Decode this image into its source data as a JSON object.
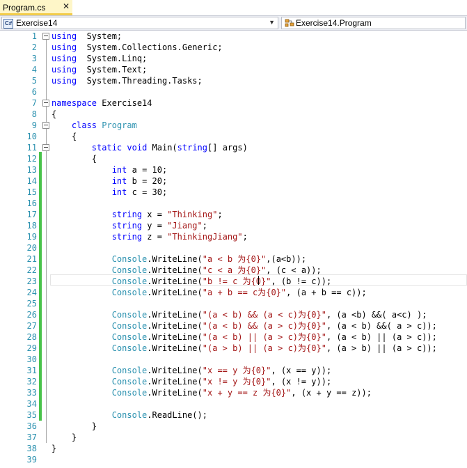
{
  "tab": {
    "label": "Program.cs",
    "close_glyph": "✕"
  },
  "navbar": {
    "project_icon": "C#",
    "project": "Exercise14",
    "member": "Exercise14.Program",
    "dropdown_glyph": "▼"
  },
  "editor": {
    "lines": [
      {
        "n": "1",
        "fold": true,
        "tokens": [
          [
            "kw",
            "using"
          ],
          [
            "",
            "  System;"
          ]
        ]
      },
      {
        "n": "2",
        "fold": false,
        "tokens": [
          [
            "kw",
            "using"
          ],
          [
            "",
            "  System.Collections.Generic;"
          ]
        ]
      },
      {
        "n": "3",
        "fold": false,
        "tokens": [
          [
            "kw",
            "using"
          ],
          [
            "",
            "  System.Linq;"
          ]
        ]
      },
      {
        "n": "4",
        "fold": false,
        "tokens": [
          [
            "kw",
            "using"
          ],
          [
            "",
            "  System.Text;"
          ]
        ]
      },
      {
        "n": "5",
        "fold": false,
        "tokens": [
          [
            "kw",
            "using"
          ],
          [
            "",
            "  System.Threading.Tasks;"
          ]
        ]
      },
      {
        "n": "6",
        "fold": false,
        "tokens": []
      },
      {
        "n": "7",
        "fold": true,
        "tokens": [
          [
            "kw",
            "namespace"
          ],
          [
            "",
            " Exercise14"
          ]
        ]
      },
      {
        "n": "8",
        "fold": false,
        "tokens": [
          [
            "",
            "{"
          ]
        ]
      },
      {
        "n": "9",
        "fold": true,
        "tokens": [
          [
            "",
            "    "
          ],
          [
            "kw",
            "class"
          ],
          [
            "",
            " "
          ],
          [
            "ty",
            "Program"
          ]
        ]
      },
      {
        "n": "10",
        "fold": false,
        "tokens": [
          [
            "",
            "    {"
          ]
        ]
      },
      {
        "n": "11",
        "fold": true,
        "tokens": [
          [
            "",
            "        "
          ],
          [
            "kw",
            "static"
          ],
          [
            "",
            " "
          ],
          [
            "kw",
            "void"
          ],
          [
            "",
            " Main("
          ],
          [
            "kw",
            "string"
          ],
          [
            "",
            "[] args)"
          ]
        ]
      },
      {
        "n": "12",
        "fold": false,
        "tokens": [
          [
            "",
            "        {"
          ]
        ]
      },
      {
        "n": "13",
        "fold": false,
        "tokens": [
          [
            "",
            "            "
          ],
          [
            "kw",
            "int"
          ],
          [
            "",
            " a = 10;"
          ]
        ]
      },
      {
        "n": "14",
        "fold": false,
        "tokens": [
          [
            "",
            "            "
          ],
          [
            "kw",
            "int"
          ],
          [
            "",
            " b = 20;"
          ]
        ]
      },
      {
        "n": "15",
        "fold": false,
        "tokens": [
          [
            "",
            "            "
          ],
          [
            "kw",
            "int"
          ],
          [
            "",
            " c = 30;"
          ]
        ]
      },
      {
        "n": "16",
        "fold": false,
        "tokens": []
      },
      {
        "n": "17",
        "fold": false,
        "tokens": [
          [
            "",
            "            "
          ],
          [
            "kw",
            "string"
          ],
          [
            "",
            " x = "
          ],
          [
            "st",
            "\"Thinking\""
          ],
          [
            "",
            ";"
          ]
        ]
      },
      {
        "n": "18",
        "fold": false,
        "tokens": [
          [
            "",
            "            "
          ],
          [
            "kw",
            "string"
          ],
          [
            "",
            " y = "
          ],
          [
            "st",
            "\"Jiang\""
          ],
          [
            "",
            ";"
          ]
        ]
      },
      {
        "n": "19",
        "fold": false,
        "tokens": [
          [
            "",
            "            "
          ],
          [
            "kw",
            "string"
          ],
          [
            "",
            " z = "
          ],
          [
            "st",
            "\"ThinkingJiang\""
          ],
          [
            "",
            ";"
          ]
        ]
      },
      {
        "n": "20",
        "fold": false,
        "tokens": []
      },
      {
        "n": "21",
        "fold": false,
        "tokens": [
          [
            "",
            "            "
          ],
          [
            "ty",
            "Console"
          ],
          [
            "",
            ".WriteLine("
          ],
          [
            "st",
            "\"a < b 为{0}\""
          ],
          [
            "",
            ",(a<b));"
          ]
        ]
      },
      {
        "n": "22",
        "fold": false,
        "tokens": [
          [
            "",
            "            "
          ],
          [
            "ty",
            "Console"
          ],
          [
            "",
            ".WriteLine("
          ],
          [
            "st",
            "\"c < a 为{0}\""
          ],
          [
            "",
            ", (c < a));"
          ]
        ]
      },
      {
        "n": "23",
        "fold": false,
        "tokens": [
          [
            "",
            "            "
          ],
          [
            "ty",
            "Console"
          ],
          [
            "",
            ".WriteLine("
          ],
          [
            "st",
            "\"b != c 为{0}\""
          ],
          [
            "",
            ", (b != c));"
          ]
        ]
      },
      {
        "n": "24",
        "fold": false,
        "tokens": [
          [
            "",
            "            "
          ],
          [
            "ty",
            "Console"
          ],
          [
            "",
            ".WriteLine("
          ],
          [
            "st",
            "\"a + b == c为{0}\""
          ],
          [
            "",
            ", (a + b == c));"
          ]
        ]
      },
      {
        "n": "25",
        "fold": false,
        "tokens": []
      },
      {
        "n": "26",
        "fold": false,
        "tokens": [
          [
            "",
            "            "
          ],
          [
            "ty",
            "Console"
          ],
          [
            "",
            ".WriteLine("
          ],
          [
            "st",
            "\"(a < b) && (a < c)为{0}\""
          ],
          [
            "",
            ", (a <b) &&( a<c) );"
          ]
        ]
      },
      {
        "n": "27",
        "fold": false,
        "tokens": [
          [
            "",
            "            "
          ],
          [
            "ty",
            "Console"
          ],
          [
            "",
            ".WriteLine("
          ],
          [
            "st",
            "\"(a < b) && (a > c)为{0}\""
          ],
          [
            "",
            ", (a < b) &&( a > c));"
          ]
        ]
      },
      {
        "n": "28",
        "fold": false,
        "tokens": [
          [
            "",
            "            "
          ],
          [
            "ty",
            "Console"
          ],
          [
            "",
            ".WriteLine("
          ],
          [
            "st",
            "\"(a < b) || (a > c)为{0}\""
          ],
          [
            "",
            ", (a < b) || (a > c));"
          ]
        ]
      },
      {
        "n": "29",
        "fold": false,
        "tokens": [
          [
            "",
            "            "
          ],
          [
            "ty",
            "Console"
          ],
          [
            "",
            ".WriteLine("
          ],
          [
            "st",
            "\"(a > b) || (a > c)为{0}\""
          ],
          [
            "",
            ", (a > b) || (a > c));"
          ]
        ]
      },
      {
        "n": "30",
        "fold": false,
        "tokens": []
      },
      {
        "n": "31",
        "fold": false,
        "tokens": [
          [
            "",
            "            "
          ],
          [
            "ty",
            "Console"
          ],
          [
            "",
            ".WriteLine("
          ],
          [
            "st",
            "\"x == y 为{0}\""
          ],
          [
            "",
            ", (x == y));"
          ]
        ]
      },
      {
        "n": "32",
        "fold": false,
        "tokens": [
          [
            "",
            "            "
          ],
          [
            "ty",
            "Console"
          ],
          [
            "",
            ".WriteLine("
          ],
          [
            "st",
            "\"x != y 为{0}\""
          ],
          [
            "",
            ", (x != y));"
          ]
        ]
      },
      {
        "n": "33",
        "fold": false,
        "tokens": [
          [
            "",
            "            "
          ],
          [
            "ty",
            "Console"
          ],
          [
            "",
            ".WriteLine("
          ],
          [
            "st",
            "\"x + y == z 为{0}\""
          ],
          [
            "",
            ", (x + y == z));"
          ]
        ]
      },
      {
        "n": "34",
        "fold": false,
        "tokens": []
      },
      {
        "n": "35",
        "fold": false,
        "tokens": [
          [
            "",
            "            "
          ],
          [
            "ty",
            "Console"
          ],
          [
            "",
            ".ReadLine();"
          ]
        ]
      },
      {
        "n": "36",
        "fold": false,
        "tokens": [
          [
            "",
            "        }"
          ]
        ]
      },
      {
        "n": "37",
        "fold": false,
        "tokens": [
          [
            "",
            "    }"
          ]
        ]
      },
      {
        "n": "38",
        "fold": false,
        "tokens": [
          [
            "",
            "}"
          ]
        ]
      },
      {
        "n": "39",
        "fold": false,
        "tokens": []
      }
    ]
  },
  "colors": {
    "keyword": "#0000ff",
    "type": "#2b91af",
    "string": "#a31515",
    "line_number": "#2b91af",
    "change_bar": "#49c34b",
    "active_tab": "#fef6c8"
  }
}
